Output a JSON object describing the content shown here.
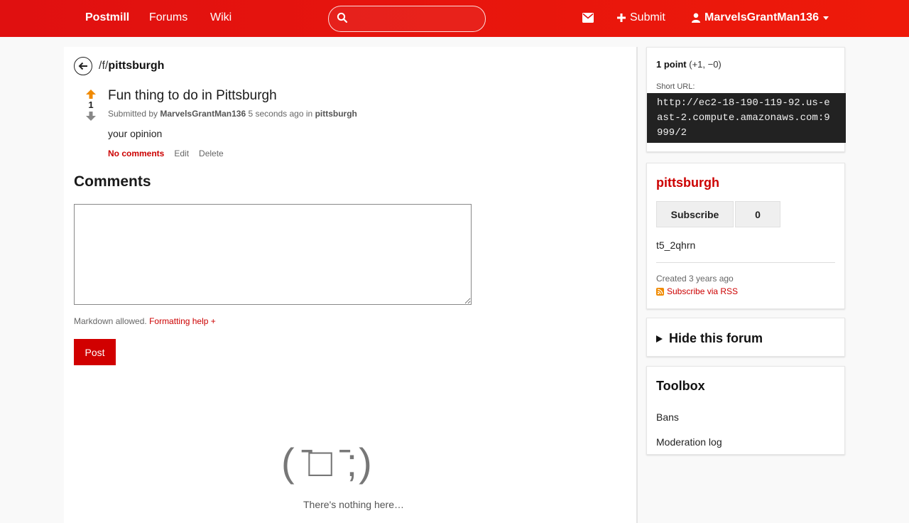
{
  "nav": {
    "brand": "Postmill",
    "forums": "Forums",
    "wiki": "Wiki",
    "search_value": "",
    "submit": "Submit",
    "user": "MarvelsGrantMan136"
  },
  "forum_header": {
    "prefix": "/f/",
    "name": "pittsburgh"
  },
  "post": {
    "score": "1",
    "title": "Fun thing to do in Pittsburgh",
    "submitted_by_label": "Submitted by",
    "author": "MarvelsGrantMan136",
    "time": "5 seconds ago",
    "in_label": "in",
    "forum": "pittsburgh",
    "body": "your opinion",
    "comments_link": "No comments",
    "edit": "Edit",
    "delete": "Delete"
  },
  "comments": {
    "heading": "Comments",
    "textarea_value": "",
    "markdown_note": "Markdown allowed.",
    "formatting_help": "Formatting help +",
    "post_button": "Post",
    "empty_face": "( ̄□ ̄;)",
    "empty_text": "There's nothing here…"
  },
  "sidebar": {
    "points_bold": "1 point",
    "points_detail": "(+1, −0)",
    "short_url_label": "Short URL:",
    "short_url": "http://ec2-18-190-119-92.us-east-2.compute.amazonaws.com:9999/2",
    "forum_name": "pittsburgh",
    "subscribe": "Subscribe",
    "subscriber_count": "0",
    "forum_id": "t5_2qhrn",
    "created": "Created 3 years ago",
    "rss": "Subscribe via RSS",
    "hide_forum": "Hide this forum",
    "toolbox_title": "Toolbox",
    "tool_bans": "Bans",
    "tool_modlog": "Moderation log"
  },
  "colors": {
    "nav_red": "#e01010",
    "accent_red": "#c00",
    "upvote_orange": "#f08a00"
  }
}
